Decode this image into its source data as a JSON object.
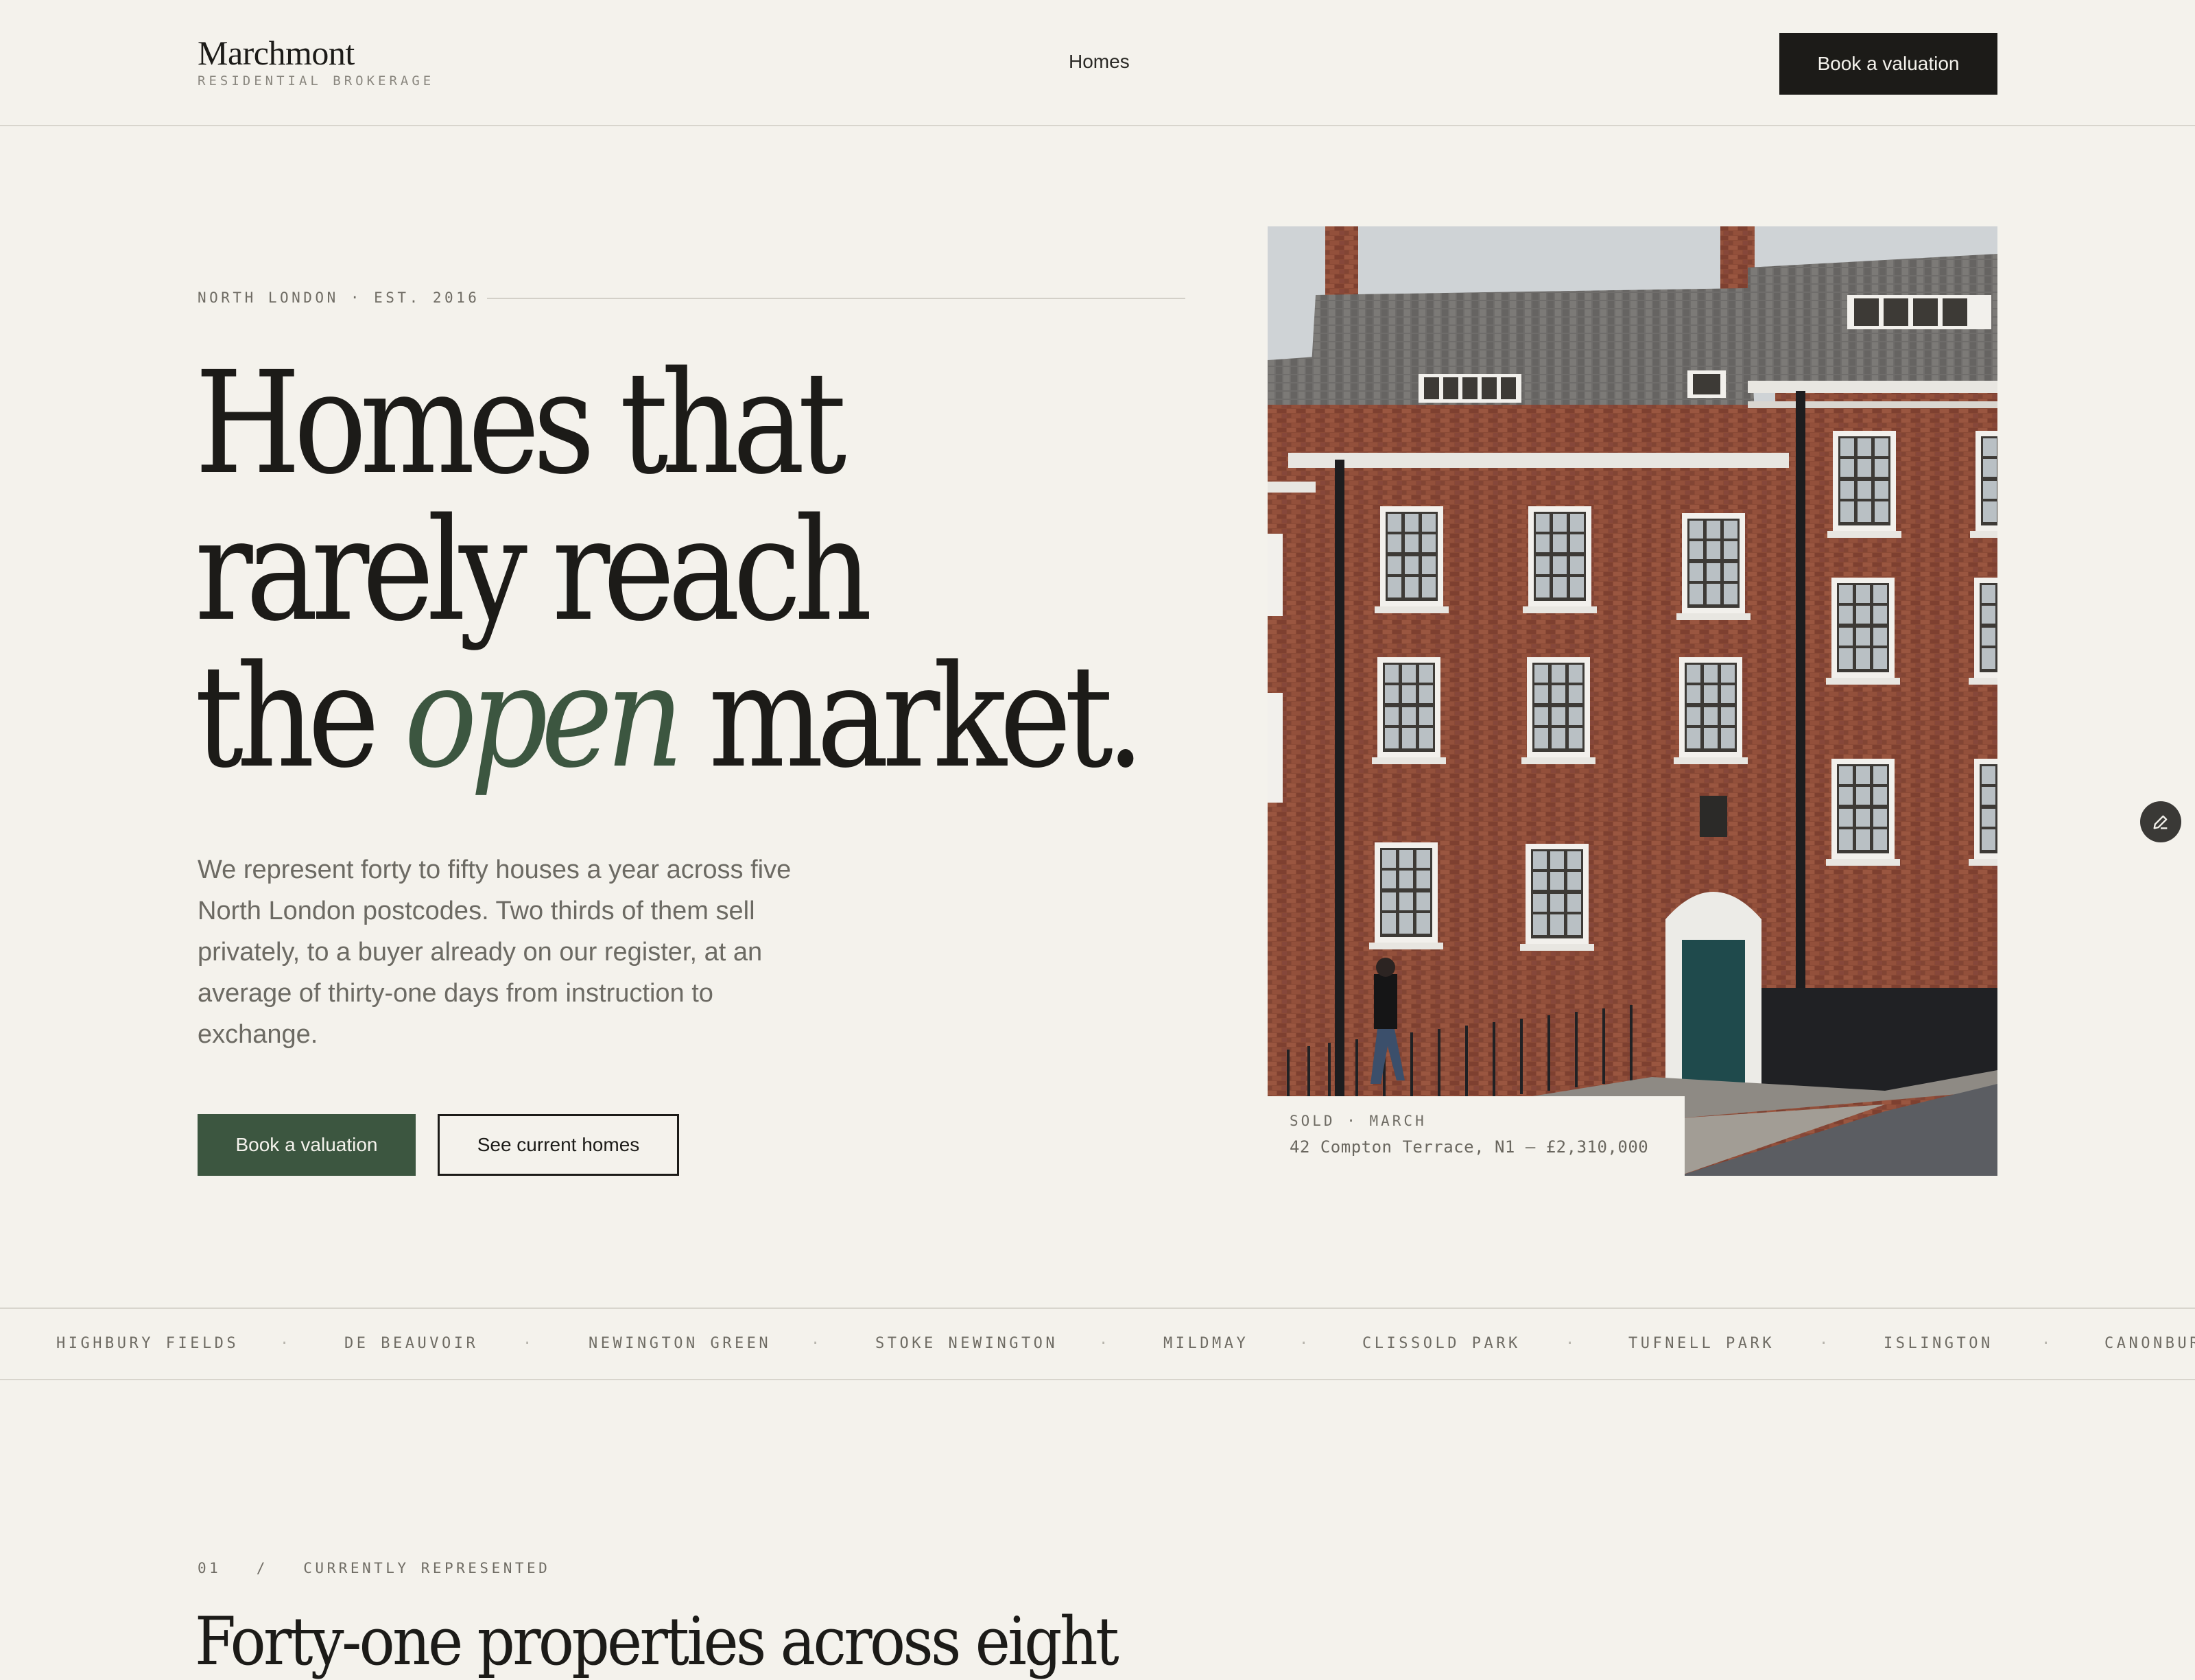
{
  "header": {
    "brand_name": "Marchmont",
    "brand_tagline": "RESIDENTIAL BROKERAGE",
    "nav_homes": "Homes",
    "cta": "Book a valuation"
  },
  "hero": {
    "eyebrow": "NORTH LONDON · EST. 2016",
    "headline_line1": "Homes that",
    "headline_line2": "rarely reach",
    "headline_line3_pre": "the ",
    "headline_line3_accent": "open",
    "headline_line3_post": " market.",
    "lede": "We represent forty to fifty houses a year across five North London postcodes. Two thirds of them sell privately, to a buyer already on our register, at an average of thirty-one days from instruction to exchange.",
    "primary_cta": "Book a valuation",
    "secondary_cta": "See current homes",
    "photo_caption": {
      "status": "SOLD · MARCH",
      "detail": "42 Compton Terrace, N1 — £2,310,000"
    }
  },
  "neighbourhoods": [
    "HIGHBURY FIELDS",
    "DE BEAUVOIR",
    "NEWINGTON GREEN",
    "STOKE NEWINGTON",
    "MILDMAY",
    "CLISSOLD PARK",
    "TUFNELL PARK",
    "ISLINGTON",
    "CANONBURY"
  ],
  "separator": "·",
  "section_01": {
    "label": "01   /   CURRENTLY REPRESENTED",
    "title": "Forty-one properties across eight"
  },
  "colors": {
    "background": "#f4f2ec",
    "ink": "#1c1b18",
    "accent_green": "#3c5640"
  },
  "icons": {
    "edit": "pencil-icon"
  }
}
